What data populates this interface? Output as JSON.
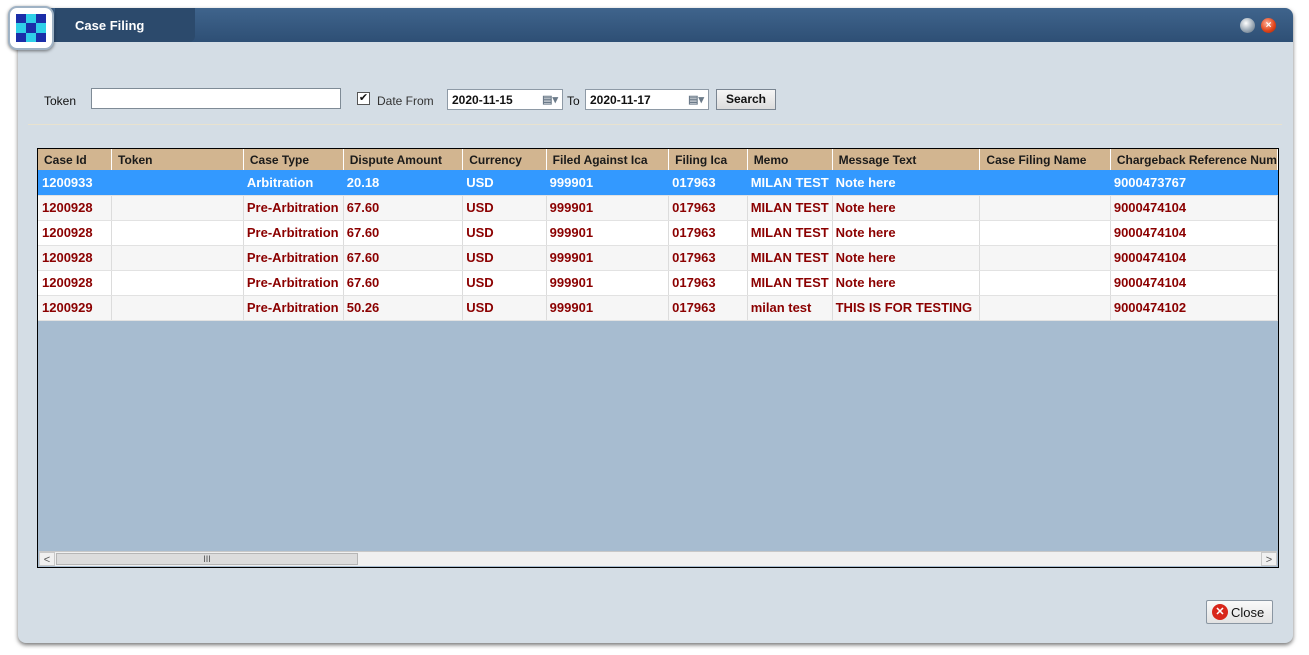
{
  "window": {
    "title": "Case Filing"
  },
  "filters": {
    "token_label": "Token",
    "token_value": "",
    "date_from_label": "Date From",
    "date_from_checked": true,
    "date_from": "2020-11-15",
    "to_label": "To",
    "date_to": "2020-11-17",
    "search_label": "Search"
  },
  "table": {
    "columns": [
      "Case Id",
      "Token",
      "Case Type",
      "Dispute Amount",
      "Currency",
      "Filed Against Ica",
      "Filing Ica",
      "Memo",
      "Message Text",
      "Case Filing Name",
      "Chargeback Reference Num"
    ],
    "rows": [
      [
        "1200933",
        "",
        "Arbitration",
        "20.18",
        "USD",
        "999901",
        "017963",
        "MILAN TEST",
        "Note here",
        "",
        "9000473767"
      ],
      [
        "1200928",
        "",
        "Pre-Arbitration",
        "67.60",
        "USD",
        "999901",
        "017963",
        "MILAN TEST",
        "Note here",
        "",
        "9000474104"
      ],
      [
        "1200928",
        "",
        "Pre-Arbitration",
        "67.60",
        "USD",
        "999901",
        "017963",
        "MILAN TEST",
        "Note here",
        "",
        "9000474104"
      ],
      [
        "1200928",
        "",
        "Pre-Arbitration",
        "67.60",
        "USD",
        "999901",
        "017963",
        "MILAN TEST",
        "Note here",
        "",
        "9000474104"
      ],
      [
        "1200928",
        "",
        "Pre-Arbitration",
        "67.60",
        "USD",
        "999901",
        "017963",
        "MILAN TEST",
        "Note here",
        "",
        "9000474104"
      ],
      [
        "1200929",
        "",
        "Pre-Arbitration",
        "50.26",
        "USD",
        "999901",
        "017963",
        "milan test",
        "THIS IS FOR TESTING",
        "",
        "9000474102"
      ]
    ],
    "selected_row": 0
  },
  "scrollbar": {
    "thumb_grip": "III",
    "left_arrow": "<",
    "right_arrow": ">"
  },
  "footer": {
    "close_label": "Close"
  },
  "colors": {
    "title_bar": "#2e4f75",
    "header": "#d2b590",
    "selection": "#3399ff",
    "row_text": "#8b0000",
    "grid_bg": "#a7bcd0"
  },
  "icons": {
    "app": "app-logo-icon",
    "minimize": "minimize-icon",
    "close": "close-icon",
    "calendar": "calendar-icon",
    "check": "checkmark-icon"
  }
}
